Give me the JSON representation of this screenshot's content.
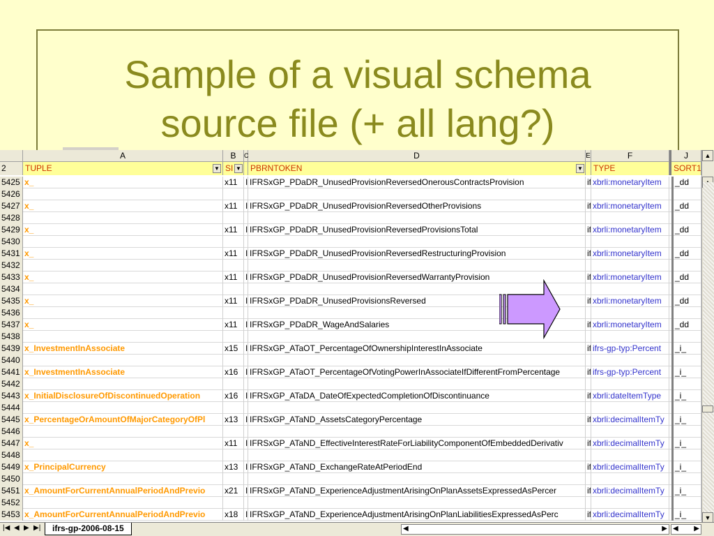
{
  "slide": {
    "title_line1": "Sample of a visual schema",
    "title_line2": "source file (+ all lang?)"
  },
  "columns": [
    "A",
    "B",
    "C",
    "D",
    "E",
    "F",
    "J"
  ],
  "header_row": {
    "row_num": "2",
    "tuple": "TUPLE",
    "b": "SI",
    "d": "PBRNTOKEN",
    "f": "TYPE",
    "j": "SORT1"
  },
  "rows": [
    {
      "n": "5425",
      "a": "x_",
      "b": "x11",
      "c": "I",
      "d": "IFRSxGP_PDaDR_UnusedProvisionReversedOnerousContractsProvision",
      "e": "if",
      "f": "xbrli:monetaryItem",
      "j": "_dd"
    },
    {
      "n": "5426"
    },
    {
      "n": "5427",
      "a": "x_",
      "b": "x11",
      "c": "I",
      "d": "IFRSxGP_PDaDR_UnusedProvisionReversedOtherProvisions",
      "e": "if",
      "f": "xbrli:monetaryItem",
      "j": "_dd"
    },
    {
      "n": "5428"
    },
    {
      "n": "5429",
      "a": "x_",
      "b": "x11",
      "c": "I",
      "d": "IFRSxGP_PDaDR_UnusedProvisionReversedProvisionsTotal",
      "e": "if",
      "f": "xbrli:monetaryItem",
      "j": "_dd"
    },
    {
      "n": "5430"
    },
    {
      "n": "5431",
      "a": "x_",
      "b": "x11",
      "c": "I",
      "d": "IFRSxGP_PDaDR_UnusedProvisionReversedRestructuringProvision",
      "e": "if",
      "f": "xbrli:monetaryItem",
      "j": "_dd"
    },
    {
      "n": "5432"
    },
    {
      "n": "5433",
      "a": "x_",
      "b": "x11",
      "c": "I",
      "d": "IFRSxGP_PDaDR_UnusedProvisionReversedWarrantyProvision",
      "e": "if",
      "f": "xbrli:monetaryItem",
      "j": "_dd"
    },
    {
      "n": "5434"
    },
    {
      "n": "5435",
      "a": "x_",
      "b": "x11",
      "c": "I",
      "d": "IFRSxGP_PDaDR_UnusedProvisionsReversed",
      "e": "if",
      "f": "xbrli:monetaryItem",
      "j": "_dd"
    },
    {
      "n": "5436"
    },
    {
      "n": "5437",
      "a": "x_",
      "b": "x11",
      "c": "I",
      "d": "IFRSxGP_PDaDR_WageAndSalaries",
      "e": "if",
      "f": "xbrli:monetaryItem",
      "j": "_dd"
    },
    {
      "n": "5438"
    },
    {
      "n": "5439",
      "a": "x_InvestmentInAssociate",
      "b": "x15",
      "c": "I",
      "d": "IFRSxGP_ATaOT_PercentageOfOwnershipInterestInAssociate",
      "e": "if",
      "f": "ifrs-gp-typ:Percent",
      "j": "_i_"
    },
    {
      "n": "5440"
    },
    {
      "n": "5441",
      "a": "x_InvestmentInAssociate",
      "b": "x16",
      "c": "I",
      "d": "IFRSxGP_ATaOT_PercentageOfVotingPowerInAssociateIfDifferentFromPercentage",
      "e": "if",
      "f": "ifrs-gp-typ:Percent",
      "j": "_i_"
    },
    {
      "n": "5442"
    },
    {
      "n": "5443",
      "a": "x_InitialDisclosureOfDiscontinuedOperation",
      "b": "x16",
      "c": "I",
      "d": "IFRSxGP_ATaDA_DateOfExpectedCompletionOfDiscontinuance",
      "e": "if",
      "f": "xbrli:dateItemType",
      "j": "_i_"
    },
    {
      "n": "5444"
    },
    {
      "n": "5445",
      "a": "x_PercentageOrAmountOfMajorCategoryOfPl",
      "b": "x13",
      "c": "I",
      "d": "IFRSxGP_ATaND_AssetsCategoryPercentage",
      "e": "if",
      "f": "xbrli:decimalItemTy",
      "j": "_i_"
    },
    {
      "n": "5446"
    },
    {
      "n": "5447",
      "a": "x_",
      "b": "x11",
      "c": "I",
      "d": "IFRSxGP_ATaND_EffectiveInterestRateForLiabilityComponentOfEmbeddedDerivativ",
      "e": "if",
      "f": "xbrli:decimalItemTy",
      "j": "_i_"
    },
    {
      "n": "5448"
    },
    {
      "n": "5449",
      "a": "x_PrincipalCurrency",
      "b": "x13",
      "c": "I",
      "d": "IFRSxGP_ATaND_ExchangeRateAtPeriodEnd",
      "e": "if",
      "f": "xbrli:decimalItemTy",
      "j": "_i_"
    },
    {
      "n": "5450"
    },
    {
      "n": "5451",
      "a": "x_AmountForCurrentAnnualPeriodAndPrevio",
      "b": "x21",
      "c": "I",
      "d": "IFRSxGP_ATaND_ExperienceAdjustmentArisingOnPlanAssetsExpressedAsPercer",
      "e": "if",
      "f": "xbrli:decimalItemTy",
      "j": "_i_"
    },
    {
      "n": "5452"
    },
    {
      "n": "5453",
      "a": "x_AmountForCurrentAnnualPeriodAndPrevio",
      "b": "x18",
      "c": "I",
      "d": "IFRSxGP_ATaND_ExperienceAdjustmentArisingOnPlanLiabilitiesExpressedAsPerc",
      "e": "if",
      "f": "xbrli:decimalItemTy",
      "j": "_i_"
    }
  ],
  "sheet_tab": "ifrs-gp-2006-08-15",
  "colors": {
    "tuple": "#FF9900",
    "type": "#3333CC",
    "background": "#FFFFCC",
    "title": "#8A8A1E",
    "arrow": "#CC99FF"
  }
}
